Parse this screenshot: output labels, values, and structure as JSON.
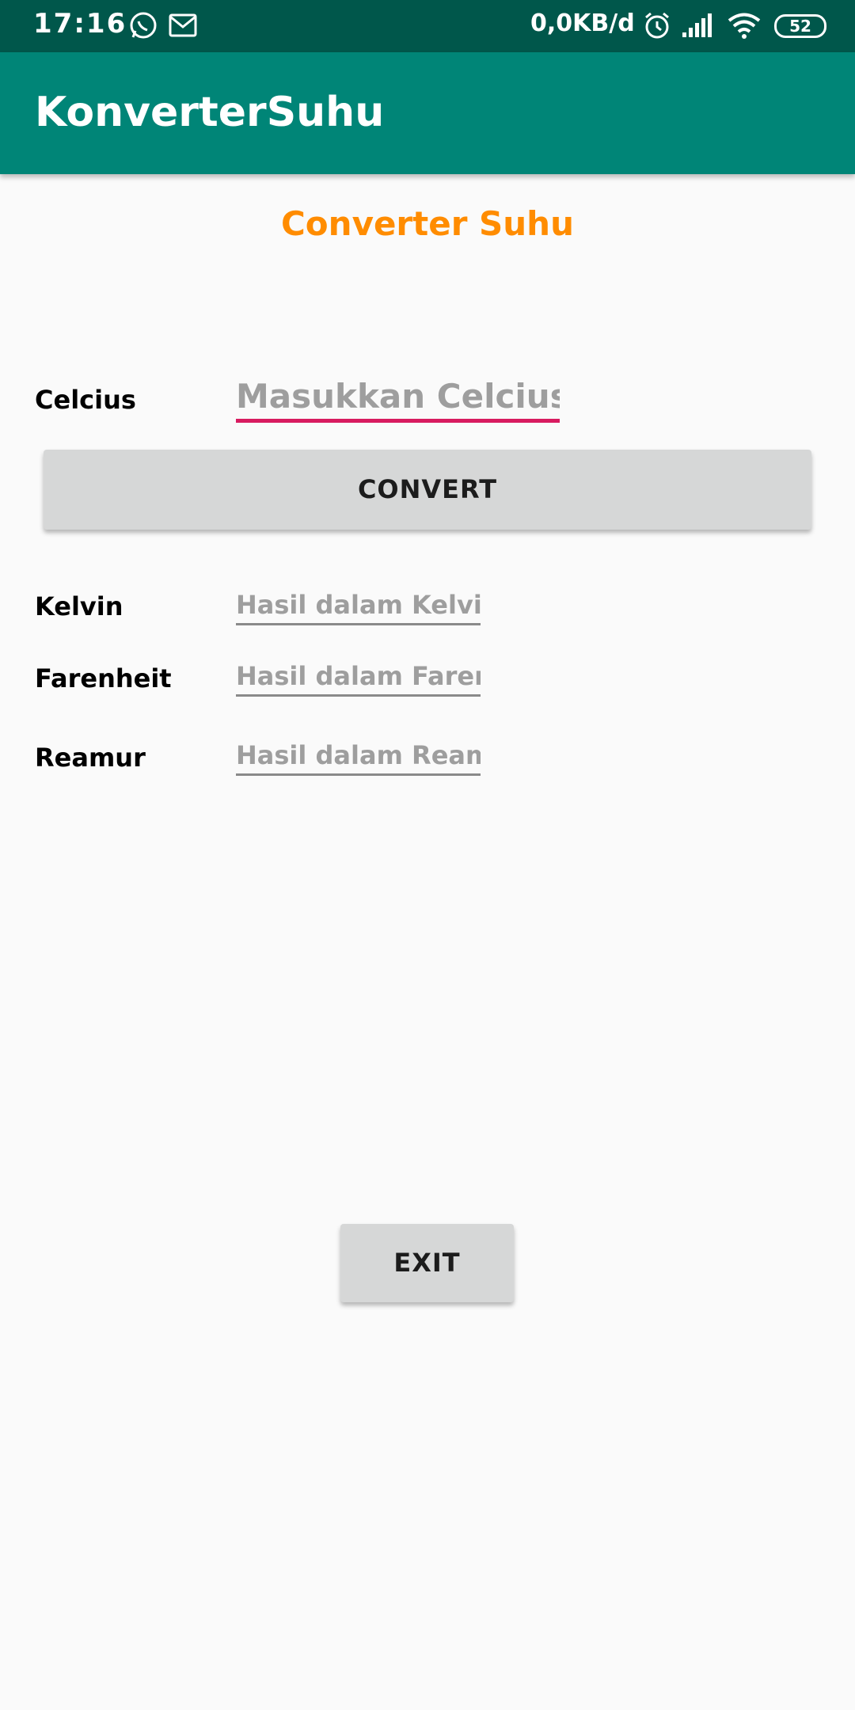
{
  "status_bar": {
    "time": "17:16",
    "net_speed": "0,0KB/d",
    "battery": "52",
    "icons": [
      "whatsapp-icon",
      "gmail-icon",
      "alarm-icon",
      "signal-icon",
      "wifi-icon",
      "battery-icon"
    ]
  },
  "app_bar": {
    "title": "KonverterSuhu",
    "color": "#008577"
  },
  "main": {
    "heading": "Converter Suhu",
    "heading_color": "#ff8c00",
    "celcius_label": "Celcius",
    "celcius_placeholder": "Masukkan Celcius",
    "convert_label": "CONVERT",
    "kelvin_label": "Kelvin",
    "kelvin_placeholder": "Hasil dalam Kelvin",
    "farenheit_label": "Farenheit",
    "farenheit_placeholder": "Hasil dalam Farenh",
    "reamur_label": "Reamur",
    "reamur_placeholder": "Hasil dalam Reamur",
    "exit_label": "EXIT",
    "accent_color": "#d81b60"
  }
}
